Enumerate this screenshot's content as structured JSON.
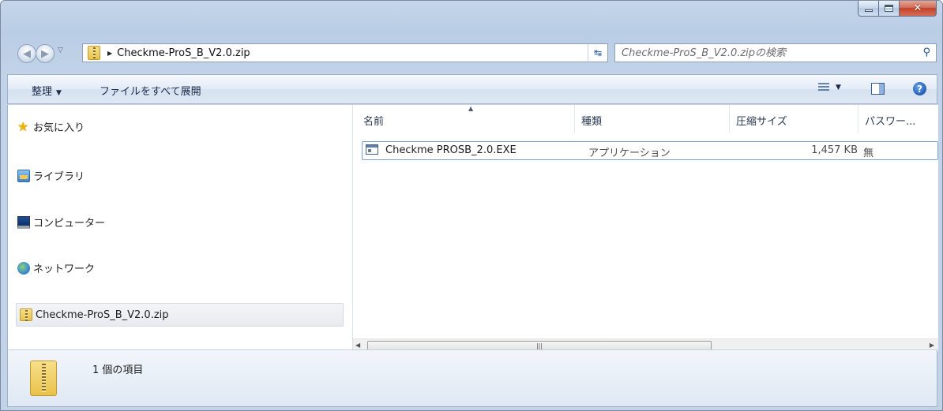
{
  "address": {
    "path": "Checkme-ProS_B_V2.0.zip"
  },
  "search": {
    "placeholder": "Checkme-ProS_B_V2.0.zipの検索"
  },
  "toolbar": {
    "organize_label": "整理",
    "extract_all_label": "ファイルをすべて展開"
  },
  "sidebar": {
    "items": [
      {
        "label": "お気に入り",
        "icon": "star-icon"
      },
      {
        "label": "ライブラリ",
        "icon": "library-icon"
      },
      {
        "label": "コンピューター",
        "icon": "computer-icon"
      },
      {
        "label": "ネットワーク",
        "icon": "network-icon"
      },
      {
        "label": "Checkme-ProS_B_V2.0.zip",
        "icon": "zip-folder-icon",
        "selected": true
      }
    ]
  },
  "columns": {
    "name": "名前",
    "type": "種類",
    "compressed_size": "圧縮サイズ",
    "password": "パスワー..."
  },
  "files": [
    {
      "name": "Checkme PROSB_2.0.EXE",
      "type": "アプリケーション",
      "compressed_size": "1,457 KB",
      "password": "無",
      "icon": "exe-icon"
    }
  ],
  "status": {
    "item_count": "1 個の項目"
  },
  "colors": {
    "frame": "#b9cde5",
    "selection_border": "#7da2ce",
    "close_button": "#c2412a"
  }
}
